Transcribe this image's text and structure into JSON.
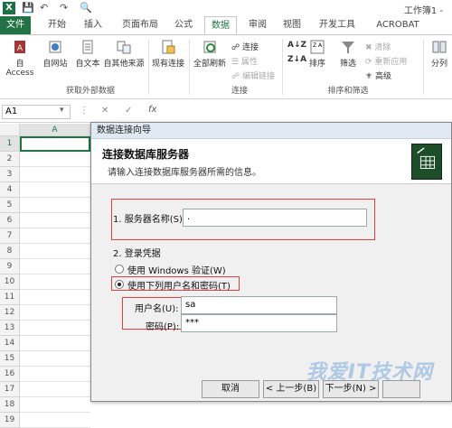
{
  "titlebar": {
    "logo": "X",
    "title": "工作簿1 -"
  },
  "tabs": {
    "file": "文件",
    "home": "开始",
    "insert": "插入",
    "layout": "页面布局",
    "formula": "公式",
    "data": "数据",
    "review": "审阅",
    "view": "视图",
    "dev": "开发工具",
    "acrobat": "ACROBAT"
  },
  "ribbon": {
    "access": "自 Access",
    "web": "自网站",
    "text": "自文本",
    "other": "自其他来源",
    "existing": "现有连接",
    "refresh": "全部刷新",
    "connections": "连接",
    "properties": "属性",
    "editlinks": "编辑链接",
    "sort": "排序",
    "filter": "筛选",
    "clear": "清除",
    "reapply": "重新应用",
    "advanced": "高级",
    "split": "分列",
    "group_external": "获取外部数据",
    "group_connections": "连接",
    "group_sortfilter": "排序和筛选"
  },
  "formula_bar": {
    "namebox": "A1",
    "fx": "fx"
  },
  "sheet": {
    "col_a": "A",
    "rows": [
      "1",
      "2",
      "3",
      "4",
      "5",
      "6",
      "7",
      "8",
      "9",
      "10",
      "11",
      "12",
      "13",
      "14",
      "15",
      "16",
      "17",
      "18",
      "19"
    ]
  },
  "dialog": {
    "title": "数据连接向导",
    "heading": "连接数据库服务器",
    "subheading": "请输入连接数据库服务器所需的信息。",
    "server_label": "1. 服务器名称(S):",
    "server_value": ".",
    "login_label": "2. 登录凭据",
    "windows_auth": "使用 Windows 验证(W)",
    "user_pass": "使用下列用户名和密码(T)",
    "username_label": "用户名(U):",
    "username_value": "sa",
    "password_label": "密码(P):",
    "password_value": "***",
    "cancel": "取消",
    "back": "< 上一步(B)",
    "next": "下一步(N) >",
    "watermark": "我爱IT技术网"
  }
}
